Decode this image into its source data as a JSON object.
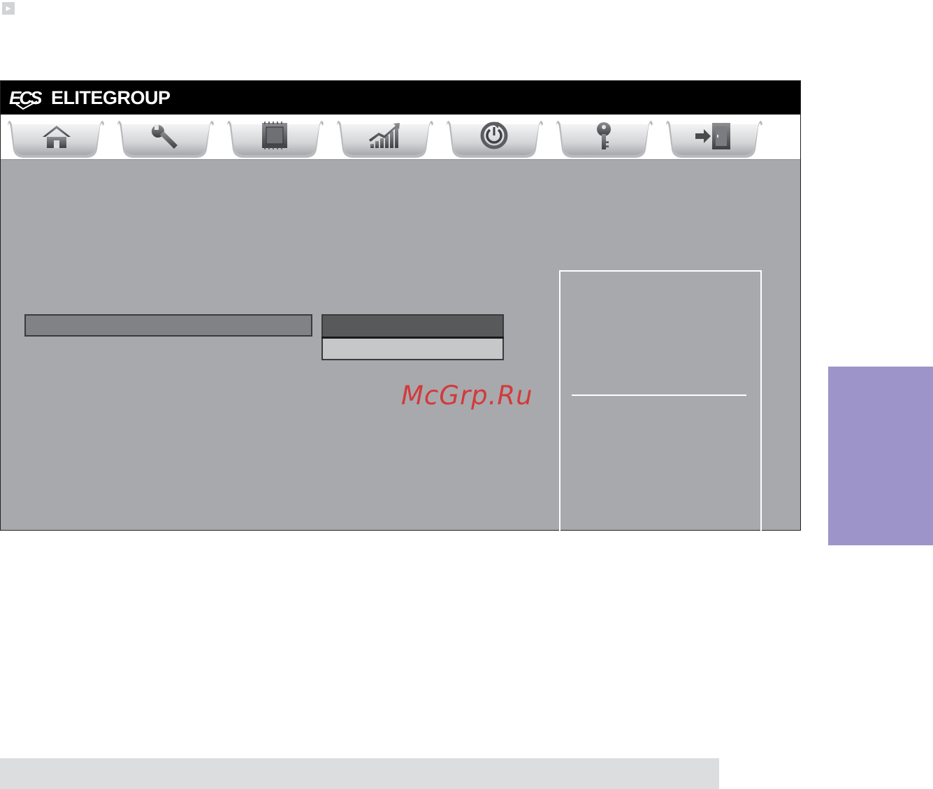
{
  "header": {
    "brand_logo": "ECS",
    "brand_name": "ELITEGROUP"
  },
  "tabs": [
    {
      "icon": "home-icon"
    },
    {
      "icon": "wrench-icon"
    },
    {
      "icon": "chip-icon"
    },
    {
      "icon": "performance-chart-icon"
    },
    {
      "icon": "power-cycle-icon"
    },
    {
      "icon": "key-icon"
    },
    {
      "icon": "exit-icon"
    }
  ],
  "watermark": {
    "text": "McGrp.Ru"
  },
  "colors": {
    "window_background": "#a8a9ad",
    "brand_bar": "#000000",
    "setting_row": "#818286",
    "option_selected": "#58595b",
    "option_item": "#c6c7c9",
    "watermark": "#d23a3a",
    "side_tab": "#9d95c9",
    "footer_band": "#dcdddf"
  }
}
